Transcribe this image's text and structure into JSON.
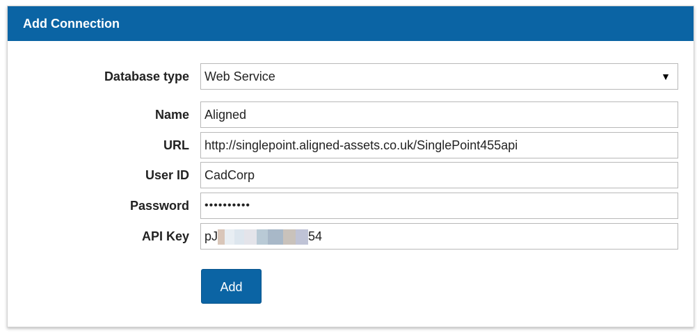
{
  "dialog": {
    "title": "Add Connection",
    "accent_color": "#0b64a4"
  },
  "form": {
    "database_type": {
      "label": "Database type",
      "value": "Web Service",
      "arrow": "▼"
    },
    "name": {
      "label": "Name",
      "value": "Aligned"
    },
    "url": {
      "label": "URL",
      "value": "http://singlepoint.aligned-assets.co.uk/SinglePoint455api"
    },
    "user_id": {
      "label": "User ID",
      "value": "CadCorp"
    },
    "password": {
      "label": "Password",
      "value": "••••••••••"
    },
    "api_key": {
      "label": "API Key",
      "value_prefix": "pJ",
      "value_suffix": "54"
    },
    "add_button": "Add"
  }
}
